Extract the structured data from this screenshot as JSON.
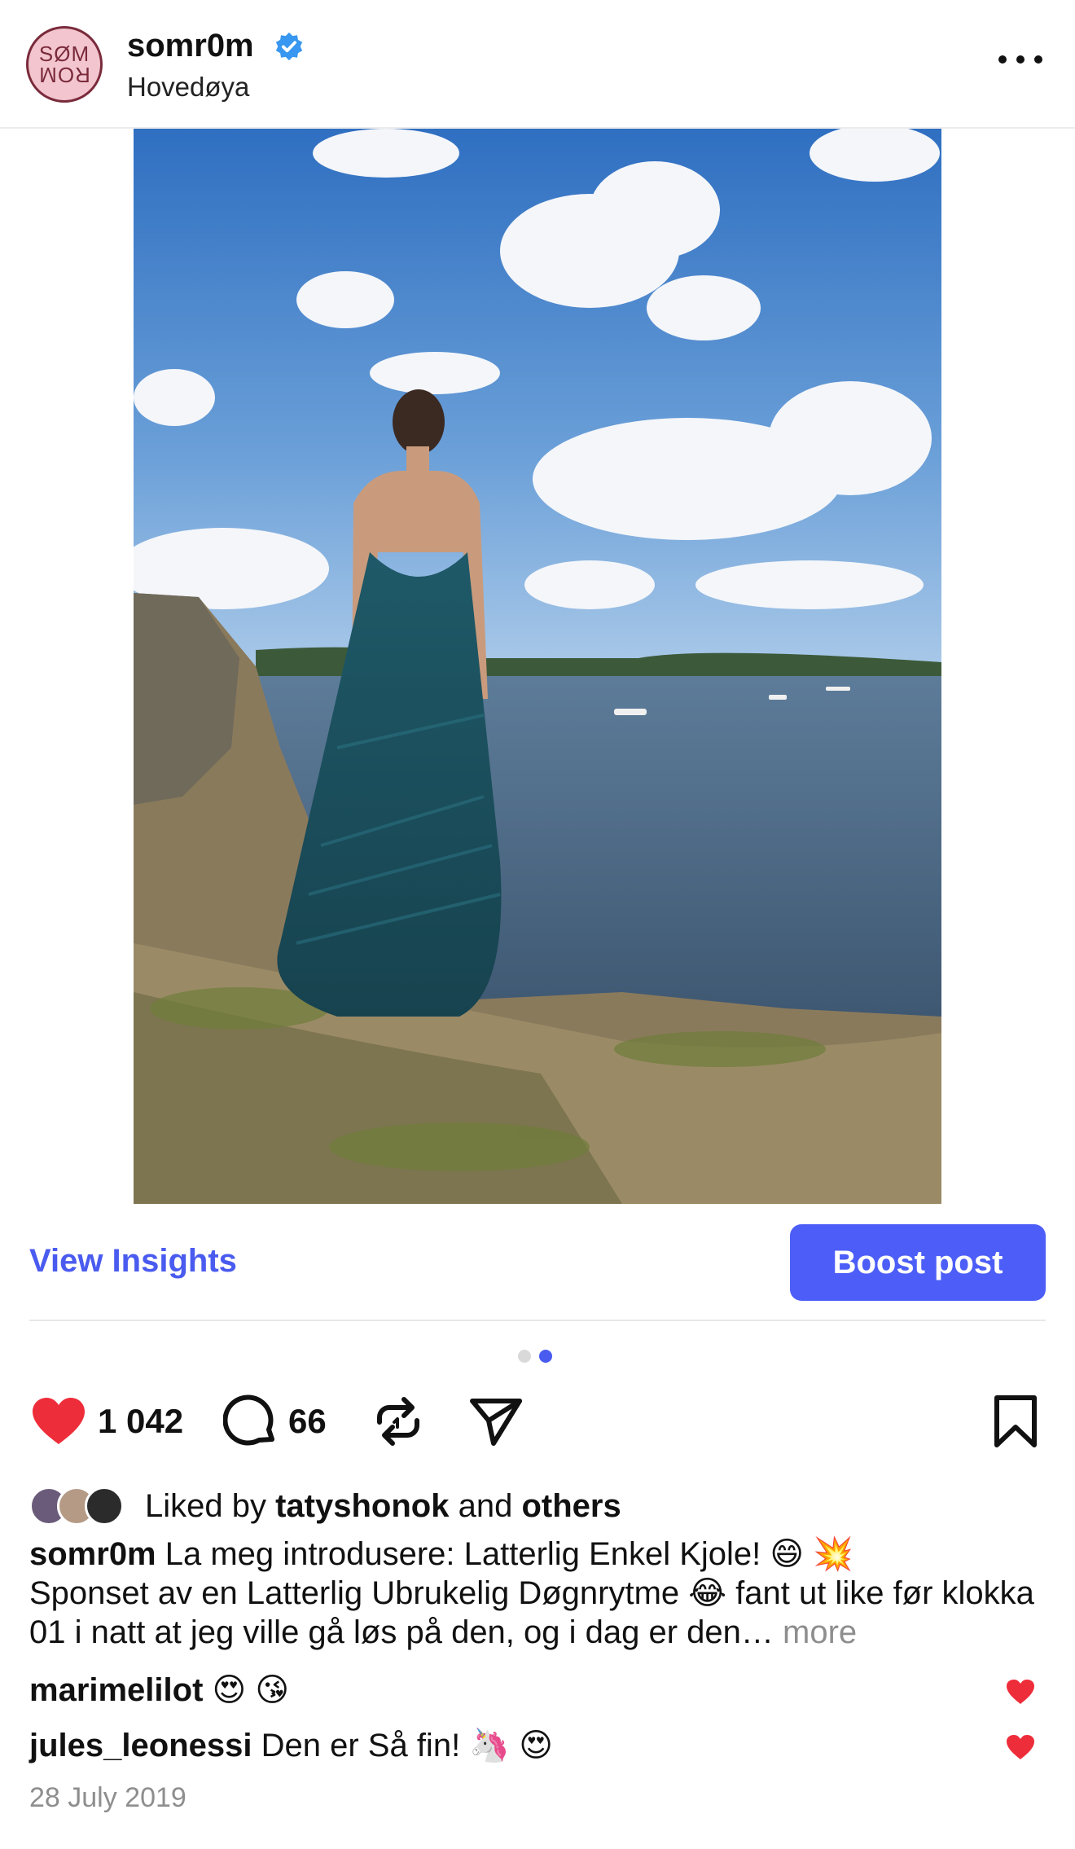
{
  "post": {
    "author": "somr0m",
    "location": "Hovedøya",
    "avatar_text_top": "SØM",
    "avatar_text_bottom": "ROM"
  },
  "actions": {
    "view_insights": "View Insights",
    "boost_post": "Boost post",
    "like_count": "1 042",
    "comment_count": "66"
  },
  "carousel": {
    "total": 2,
    "active_index": 2
  },
  "likes": {
    "prefix": "Liked by",
    "first_user": "tatyshonok",
    "joiner": "and",
    "others": "others"
  },
  "caption": {
    "author": "somr0m",
    "text_part1": "La meg introdusere: Latterlig Enkel Kjole! 😄 💥",
    "text_part2": "Sponset av en Latterlig Ubrukelig Døgnrytme 😂 fant ut like før klokka 01 i natt at jeg ville gå løs på den, og i dag er den…",
    "more": "more"
  },
  "comments": [
    {
      "user": "marimelilot",
      "text": "😍 😘"
    },
    {
      "user": "jules_leonessi",
      "text": "Den er Så fin! 🦄 😍"
    }
  ],
  "date": "28 July 2019",
  "colors": {
    "accent": "#4c5ef7",
    "like_red": "#ee2d3a",
    "verified_blue": "#3897f0"
  },
  "icons": [
    "verified-icon",
    "more-icon",
    "heart-icon",
    "comment-icon",
    "repost-icon",
    "share-icon",
    "bookmark-icon"
  ]
}
